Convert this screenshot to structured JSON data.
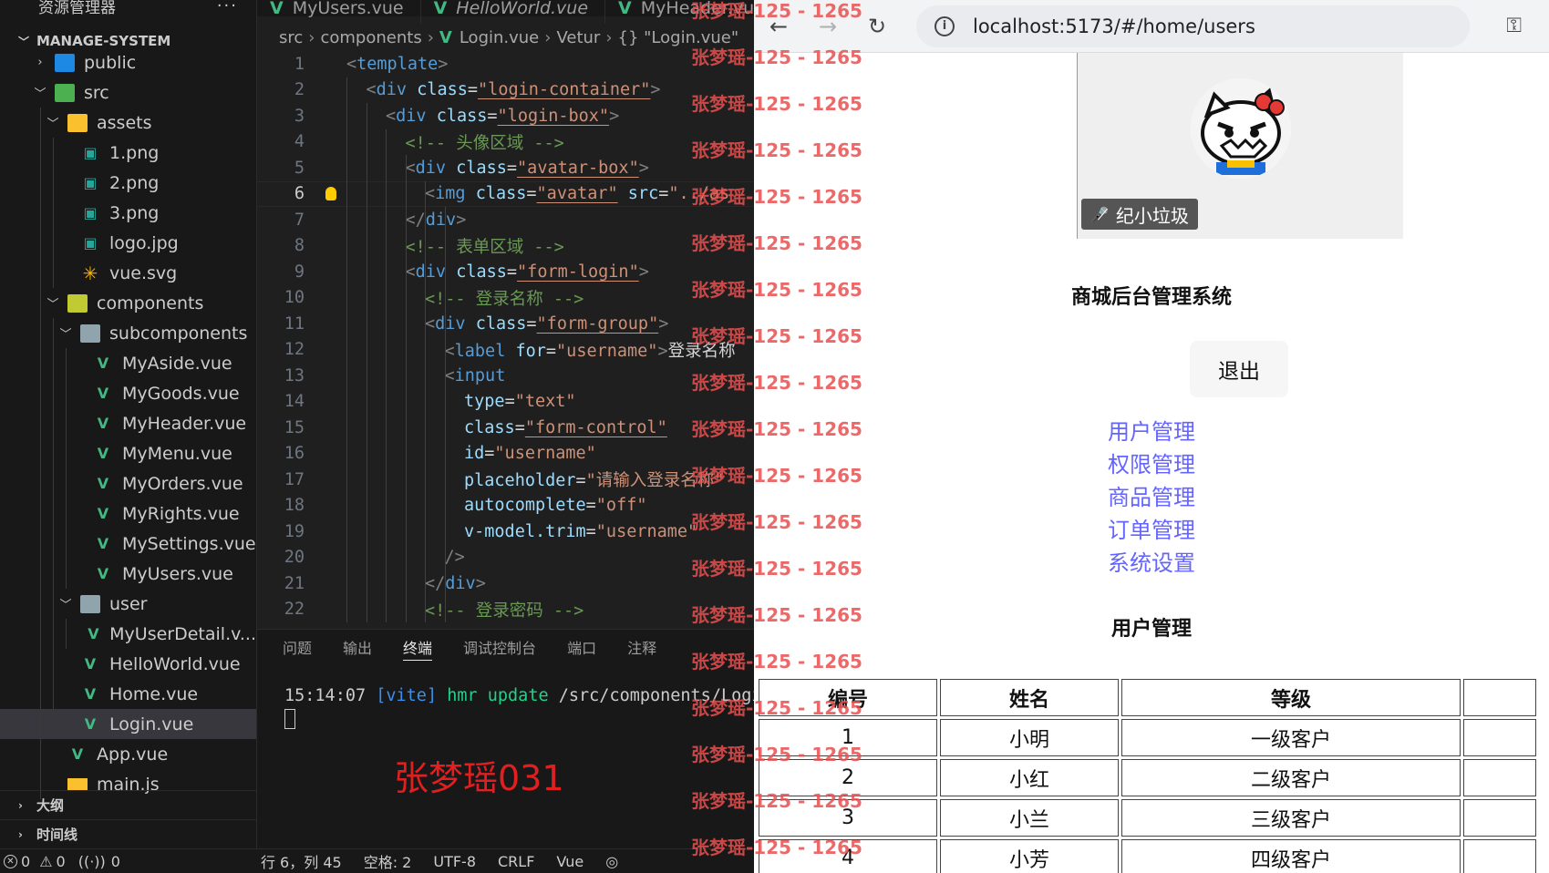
{
  "explorer": {
    "title": "资源管理器",
    "more": "···",
    "project": "MANAGE-SYSTEM",
    "items": [
      {
        "label": "public",
        "type": "folder",
        "depth": 1,
        "open": false
      },
      {
        "label": "src",
        "type": "folder",
        "depth": 1,
        "open": true
      },
      {
        "label": "assets",
        "type": "folder",
        "depth": 2,
        "open": true
      },
      {
        "label": "1.png",
        "type": "png",
        "depth": 3
      },
      {
        "label": "2.png",
        "type": "png",
        "depth": 3
      },
      {
        "label": "3.png",
        "type": "png",
        "depth": 3
      },
      {
        "label": "logo.jpg",
        "type": "png",
        "depth": 3
      },
      {
        "label": "vue.svg",
        "type": "svg",
        "depth": 3
      },
      {
        "label": "components",
        "type": "folder",
        "depth": 2,
        "open": true
      },
      {
        "label": "subcomponents",
        "type": "folder",
        "depth": 3,
        "open": true
      },
      {
        "label": "MyAside.vue",
        "type": "vue",
        "depth": 4
      },
      {
        "label": "MyGoods.vue",
        "type": "vue",
        "depth": 4
      },
      {
        "label": "MyHeader.vue",
        "type": "vue",
        "depth": 4
      },
      {
        "label": "MyMenu.vue",
        "type": "vue",
        "depth": 4
      },
      {
        "label": "MyOrders.vue",
        "type": "vue",
        "depth": 4
      },
      {
        "label": "MyRights.vue",
        "type": "vue",
        "depth": 4
      },
      {
        "label": "MySettings.vue",
        "type": "vue",
        "depth": 4
      },
      {
        "label": "MyUsers.vue",
        "type": "vue",
        "depth": 4
      },
      {
        "label": "user",
        "type": "folder",
        "depth": 3,
        "open": true
      },
      {
        "label": "MyUserDetail.v...",
        "type": "vue",
        "depth": 4
      },
      {
        "label": "HelloWorld.vue",
        "type": "vue",
        "depth": 3
      },
      {
        "label": "Home.vue",
        "type": "vue",
        "depth": 3
      },
      {
        "label": "Login.vue",
        "type": "vue",
        "depth": 3,
        "selected": true
      },
      {
        "label": "App.vue",
        "type": "vue",
        "depth": 2
      },
      {
        "label": "main.js",
        "type": "js",
        "depth": 2
      }
    ],
    "outline": "大纲",
    "timeline": "时间线"
  },
  "editor": {
    "tabs": [
      {
        "label": "MyUsers.vue",
        "italic": false
      },
      {
        "label": "HelloWorld.vue",
        "italic": true
      },
      {
        "label": "MyHeader.vue",
        "italic": false
      }
    ],
    "breadcrumb": [
      "src",
      "components",
      "Login.vue",
      "Vetur",
      "{} \"Login.vue\""
    ],
    "active_line": 6,
    "lines": [
      {
        "n": "1",
        "indent": 0,
        "html": "<span class='t-br'>&lt;</span><span class='t-tag'>template</span><span class='t-br'>&gt;</span>"
      },
      {
        "n": "2",
        "indent": 1,
        "html": "<span class='t-br'>&lt;</span><span class='t-tag'>div</span> <span class='t-attr'>class</span><span class='t-txt'>=</span><span class='t-str-u'>\"login-container\"</span><span class='t-br'>&gt;</span>"
      },
      {
        "n": "3",
        "indent": 2,
        "html": "<span class='t-br'>&lt;</span><span class='t-tag'>div</span> <span class='t-attr'>class</span><span class='t-txt'>=</span><span class='t-str-u'>\"login-box\"</span><span class='t-br'>&gt;</span>"
      },
      {
        "n": "4",
        "indent": 3,
        "html": "<span class='t-cm'>&lt;!-- 头像区域 --&gt;</span>"
      },
      {
        "n": "5",
        "indent": 3,
        "html": "<span class='t-br'>&lt;</span><span class='t-tag'>div</span> <span class='t-attr'>class</span><span class='t-txt'>=</span><span class='t-str-u'>\"avatar-box\"</span><span class='t-br'>&gt;</span>"
      },
      {
        "n": "6",
        "indent": 4,
        "html": "<span class='t-br'>&lt;</span><span class='t-tag'>img</span> <span class='t-attr'>class</span><span class='t-txt'>=</span><span class='t-str-u'>\"avatar\"</span> <span class='t-attr'>src</span><span class='t-txt'>=</span><span class='t-str'>\"../as</span>"
      },
      {
        "n": "7",
        "indent": 3,
        "html": "<span class='t-br'>&lt;/</span><span class='t-tag'>div</span><span class='t-br'>&gt;</span>"
      },
      {
        "n": "8",
        "indent": 3,
        "html": "<span class='t-cm'>&lt;!-- 表单区域 --&gt;</span>"
      },
      {
        "n": "9",
        "indent": 3,
        "html": "<span class='t-br'>&lt;</span><span class='t-tag'>div</span> <span class='t-attr'>class</span><span class='t-txt'>=</span><span class='t-str-u'>\"form-login\"</span><span class='t-br'>&gt;</span>"
      },
      {
        "n": "10",
        "indent": 4,
        "html": "<span class='t-cm'>&lt;!-- 登录名称 --&gt;</span>"
      },
      {
        "n": "11",
        "indent": 4,
        "html": "<span class='t-br'>&lt;</span><span class='t-tag'>div</span> <span class='t-attr'>class</span><span class='t-txt'>=</span><span class='t-str-u'>\"form-group\"</span><span class='t-br'>&gt;</span>"
      },
      {
        "n": "12",
        "indent": 5,
        "html": "<span class='t-br'>&lt;</span><span class='t-tag'>label</span> <span class='t-attr'>for</span><span class='t-txt'>=</span><span class='t-str'>\"username\"</span><span class='t-br'>&gt;</span><span class='t-txt'>登录名称</span>"
      },
      {
        "n": "13",
        "indent": 5,
        "html": "<span class='t-br'>&lt;</span><span class='t-tag'>input</span>"
      },
      {
        "n": "14",
        "indent": 6,
        "html": "<span class='t-attr'>type</span><span class='t-txt'>=</span><span class='t-str'>\"text\"</span>"
      },
      {
        "n": "15",
        "indent": 6,
        "html": "<span class='t-attr'>class</span><span class='t-txt'>=</span><span class='t-str-u'>\"form-control\"</span>"
      },
      {
        "n": "16",
        "indent": 6,
        "html": "<span class='t-attr'>id</span><span class='t-txt'>=</span><span class='t-str'>\"username\"</span>"
      },
      {
        "n": "17",
        "indent": 6,
        "html": "<span class='t-attr'>placeholder</span><span class='t-txt'>=</span><span class='t-str'>\"请输入登录名称\"</span>"
      },
      {
        "n": "18",
        "indent": 6,
        "html": "<span class='t-attr'>autocomplete</span><span class='t-txt'>=</span><span class='t-str'>\"off\"</span>"
      },
      {
        "n": "19",
        "indent": 6,
        "html": "<span class='t-attr'>v-model.trim</span><span class='t-txt'>=</span><span class='t-str'>\"username\"</span>"
      },
      {
        "n": "20",
        "indent": 5,
        "html": "<span class='t-br'>/&gt;</span>"
      },
      {
        "n": "21",
        "indent": 4,
        "html": "<span class='t-br'>&lt;/</span><span class='t-tag'>div</span><span class='t-br'>&gt;</span>"
      },
      {
        "n": "22",
        "indent": 4,
        "html": "<span class='t-cm'>&lt;!-- 登录密码 --&gt;</span>"
      }
    ]
  },
  "panel": {
    "tabs": [
      "问题",
      "输出",
      "终端",
      "调试控制台",
      "端口",
      "注释"
    ],
    "active_tab": "终端",
    "terminal_time": "15:14:07",
    "terminal_tag": "[vite]",
    "terminal_action": "hmr update",
    "terminal_path": "/src/components/Logi",
    "overlay_name": "张梦瑶031"
  },
  "statusbar": {
    "errors": "0",
    "warnings": "0",
    "ports": "0",
    "position": "行 6，列 45",
    "spaces": "空格: 2",
    "encoding": "UTF-8",
    "eol": "CRLF",
    "language": "Vue"
  },
  "watermark": {
    "name": "张梦瑶",
    "suffix": "-125 - 1265"
  },
  "browser": {
    "url": "localhost:5173/#/home/users",
    "avatar_name": "纪小垃圾",
    "site_title": "商城后台管理系统",
    "logout_label": "退出",
    "menu": [
      "用户管理",
      "权限管理",
      "商品管理",
      "订单管理",
      "系统设置"
    ],
    "section_title": "用户管理",
    "table": {
      "headers": [
        "编号",
        "姓名",
        "等级"
      ],
      "rows": [
        [
          "1",
          "小明",
          "一级客户"
        ],
        [
          "2",
          "小红",
          "二级客户"
        ],
        [
          "3",
          "小兰",
          "三级客户"
        ],
        [
          "4",
          "小芳",
          "四级客户"
        ]
      ]
    }
  }
}
